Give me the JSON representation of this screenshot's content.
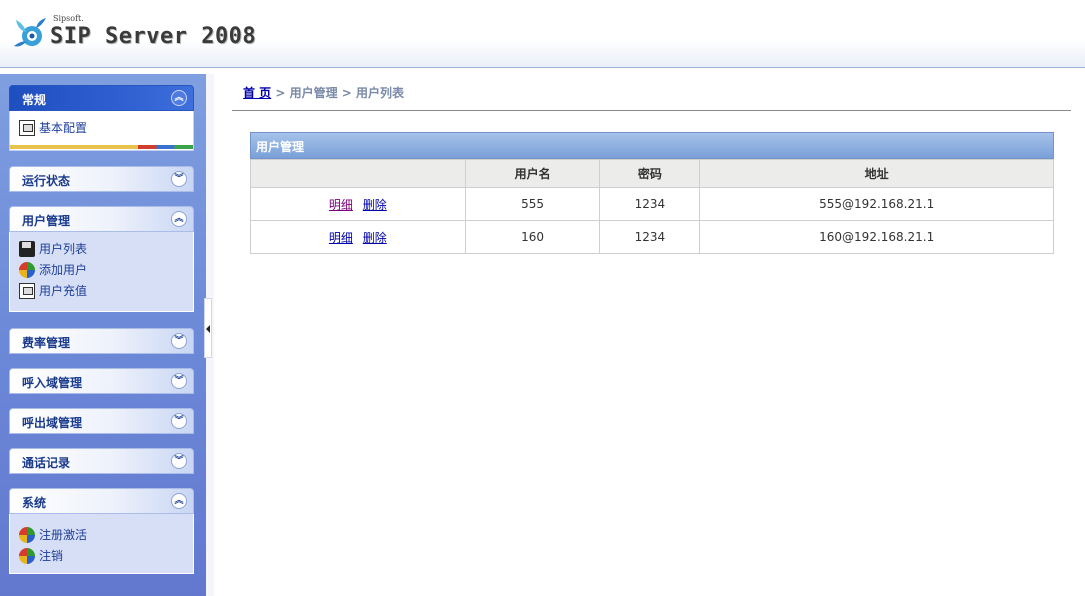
{
  "header": {
    "brand_small": "Sipsoft.",
    "brand_title": "SIP Server 2008"
  },
  "sidebar": {
    "panels": [
      {
        "title": "常规",
        "state": "expanded",
        "items": [
          {
            "label": "基本配置",
            "icon": "config-icon"
          }
        ]
      },
      {
        "title": "运行状态",
        "state": "collapsed",
        "items": []
      },
      {
        "title": "用户管理",
        "state": "expanded",
        "items": [
          {
            "label": "用户列表",
            "icon": "disk-icon"
          },
          {
            "label": "添加用户",
            "icon": "globe-icon"
          },
          {
            "label": "用户充值",
            "icon": "config-icon"
          }
        ]
      },
      {
        "title": "费率管理",
        "state": "collapsed",
        "items": []
      },
      {
        "title": "呼入域管理",
        "state": "collapsed",
        "items": []
      },
      {
        "title": "呼出域管理",
        "state": "collapsed",
        "items": []
      },
      {
        "title": "通话记录",
        "state": "collapsed",
        "items": []
      },
      {
        "title": "系统",
        "state": "expanded",
        "items": [
          {
            "label": "注册激活",
            "icon": "globe-icon"
          },
          {
            "label": "注销",
            "icon": "globe-icon"
          }
        ]
      }
    ],
    "chevron_up": "︽",
    "chevron_down": "︾"
  },
  "breadcrumb": {
    "home": "首 页",
    "sep1": " > ",
    "level1": "用户管理",
    "sep2": " > ",
    "level2": "用户列表"
  },
  "grid": {
    "title": "用户管理",
    "columns": [
      "",
      "用户名",
      "密码",
      "地址"
    ],
    "action_detail": "明细",
    "action_delete": "删除",
    "rows": [
      {
        "username": "555",
        "password": "1234",
        "address": "555@192.168.21.1"
      },
      {
        "username": "160",
        "password": "1234",
        "address": "160@192.168.21.1"
      }
    ]
  }
}
